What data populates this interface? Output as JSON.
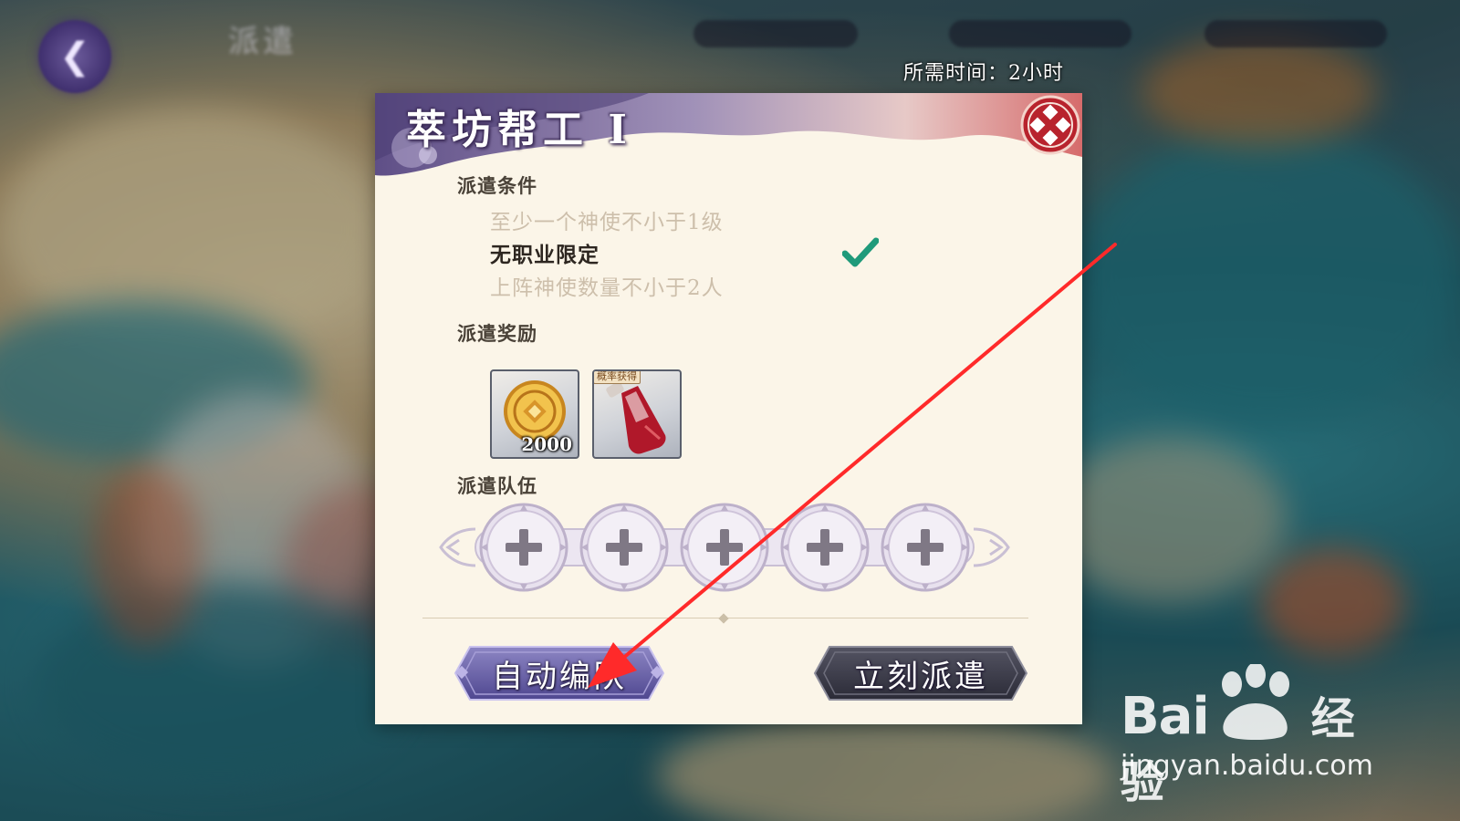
{
  "hud": {
    "back_icon": "back-arrow-icon",
    "title": "派遣",
    "time_required": "所需时间：2小时"
  },
  "dialog": {
    "title": "萃坊帮工 I",
    "close_icon": "close-ornament-icon",
    "conditions_label": "派遣条件",
    "conditions": [
      {
        "text": "至少一个神使不小于1级",
        "met": false
      },
      {
        "text": "无职业限定",
        "met": true
      },
      {
        "text": "上阵神使数量不小于2人",
        "met": false
      }
    ],
    "rewards_label": "派遣奖励",
    "rewards": [
      {
        "icon": "gold-coin-icon",
        "quantity": "2000"
      },
      {
        "icon": "red-potion-bottle-icon",
        "tag": "概率获得"
      }
    ],
    "team_label": "派遣队伍",
    "team_slots": 5,
    "slot_icon": "plus-icon",
    "auto_team_button": "自动编队",
    "dispatch_button": "立刻派遣"
  },
  "colors": {
    "annotation_arrow": "#ff2a2a",
    "check": "#1f9a7a",
    "banner": "#8a79a8",
    "auto_button": "#6d63a8",
    "dispatch_button": "#3a3a48"
  },
  "watermark": {
    "brand": "Bai",
    "brand_suffix": "经验",
    "url": "jingyan.baidu.com"
  }
}
